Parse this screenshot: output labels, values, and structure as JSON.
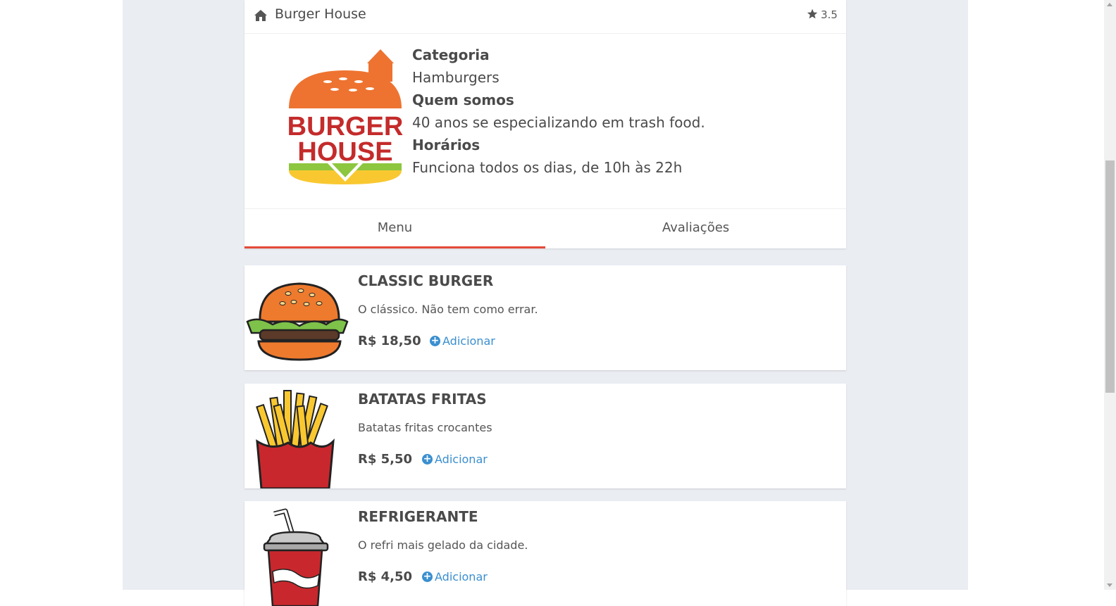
{
  "restaurant": {
    "name": "Burger House",
    "rating": "3.5",
    "logo": {
      "line1": "BURGER",
      "line2": "HOUSE"
    },
    "info": [
      {
        "label": "Categoria",
        "value": "Hamburgers"
      },
      {
        "label": "Quem somos",
        "value": "40 anos se especializando em trash food."
      },
      {
        "label": "Horários",
        "value": "Funciona todos os dias, de 10h às 22h"
      }
    ]
  },
  "tabs": [
    {
      "label": "Menu",
      "active": true
    },
    {
      "label": "Avaliações",
      "active": false
    }
  ],
  "menu": [
    {
      "name": "CLASSIC BURGER",
      "description": "O clássico. Não tem como errar.",
      "price": "R$ 18,50",
      "add_label": "Adicionar",
      "icon": "burger-image"
    },
    {
      "name": "BATATAS FRITAS",
      "description": "Batatas fritas crocantes",
      "price": "R$ 5,50",
      "add_label": "Adicionar",
      "icon": "fries-image"
    },
    {
      "name": "REFRIGERANTE",
      "description": "O refri mais gelado da cidade.",
      "price": "R$ 4,50",
      "add_label": "Adicionar",
      "icon": "soda-image"
    }
  ],
  "colors": {
    "accent": "#e44a3a",
    "link": "#3a8fd0",
    "background": "#eaedf2"
  }
}
